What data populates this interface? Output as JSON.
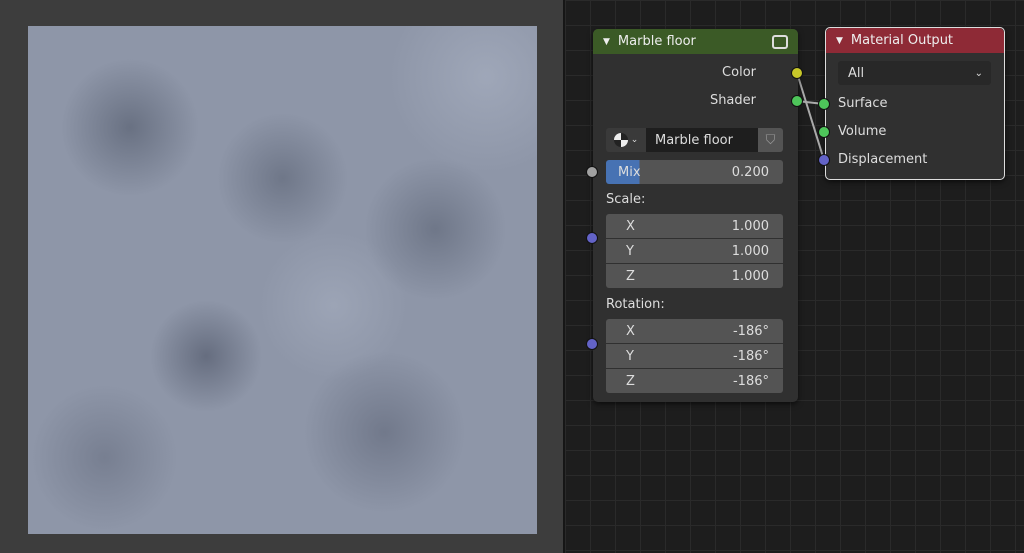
{
  "image_editor": {
    "texture": "marble-noise"
  },
  "group_node": {
    "title": "Marble floor",
    "outputs": {
      "color": "Color",
      "shader": "Shader"
    },
    "datablock": "Marble floor",
    "mix": {
      "label": "Mix",
      "value": "0.200",
      "fraction": 0.2
    },
    "scale": {
      "label": "Scale:",
      "x_label": "X",
      "x": "1.000",
      "y_label": "Y",
      "y": "1.000",
      "z_label": "Z",
      "z": "1.000"
    },
    "rotation": {
      "label": "Rotation:",
      "x_label": "X",
      "x": "-186°",
      "y_label": "Y",
      "y": "-186°",
      "z_label": "Z",
      "z": "-186°"
    }
  },
  "output_node": {
    "title": "Material Output",
    "target": "All",
    "inputs": {
      "surface": "Surface",
      "volume": "Volume",
      "displacement": "Displacement"
    }
  },
  "colors": {
    "group_header": "#3b5a26",
    "output_header": "#8e2a36",
    "color_socket": "#c7c729",
    "shader_socket": "#4ec55a",
    "vector_socket": "#6363c7"
  }
}
